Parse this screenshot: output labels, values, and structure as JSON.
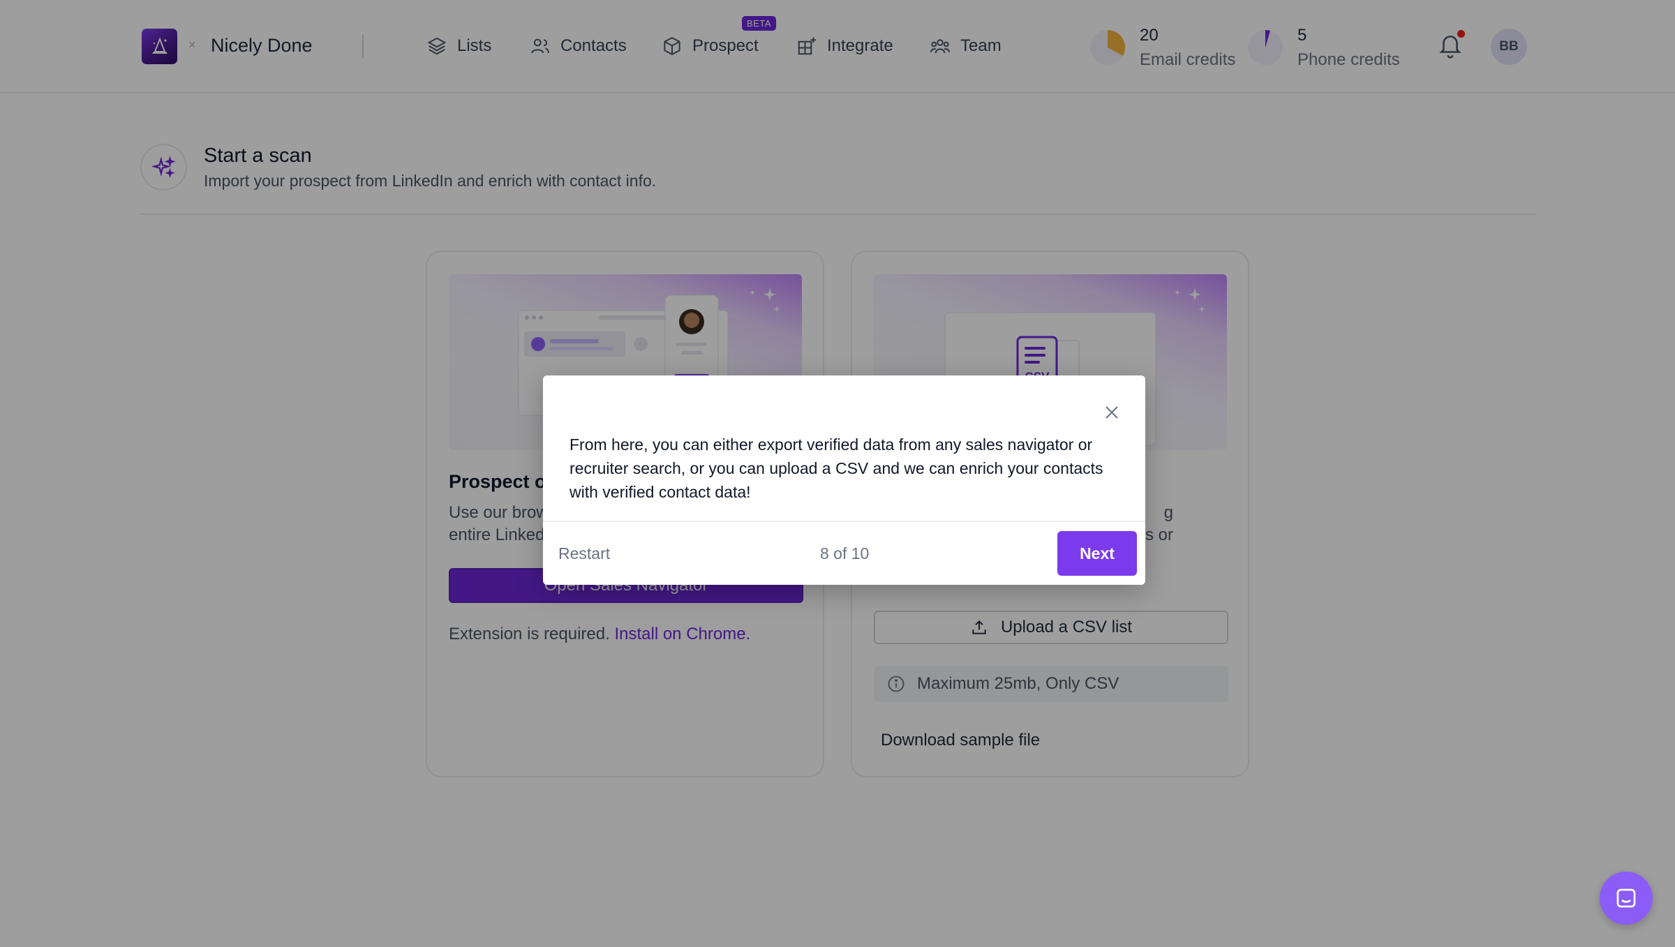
{
  "header": {
    "workspace_name": "Nicely Done",
    "nav": [
      {
        "label": "Lists",
        "icon": "layers-icon"
      },
      {
        "label": "Contacts",
        "icon": "users-icon"
      },
      {
        "label": "Prospect",
        "icon": "cube-icon",
        "badge": "BETA"
      },
      {
        "label": "Integrate",
        "icon": "grid-plus-icon"
      },
      {
        "label": "Team",
        "icon": "team-icon"
      }
    ],
    "credits": [
      {
        "value": "20",
        "label": "Email credits",
        "color": "#f5b340"
      },
      {
        "value": "5",
        "label": "Phone credits",
        "color": "#6d28d9"
      }
    ],
    "avatar_initials": "BB",
    "accent_color": "#6d28d9"
  },
  "page": {
    "title": "Start a scan",
    "subtitle": "Import your prospect from LinkedIn and enrich with contact info."
  },
  "cards": {
    "linkedin": {
      "title": "Prospect or",
      "text_line1": "Use our brow",
      "text_line2": "entire Linked",
      "button_label": "Open Sales Navigator",
      "ext_note": "Extension is required.",
      "ext_link": "Install on Chrome."
    },
    "csv": {
      "text_line1": "g",
      "text_line2": "s or",
      "hero_label": "CSV",
      "upload_label": "Upload a CSV list",
      "info_text": "Maximum 25mb, Only CSV",
      "download_label": "Download sample file"
    }
  },
  "tour": {
    "text": "From here, you can either export verified data from any sales navigator or recruiter search, or you can upload a CSV and we can enrich your contacts with verified contact data!",
    "restart_label": "Restart",
    "progress": "8 of 10",
    "next_label": "Next"
  }
}
